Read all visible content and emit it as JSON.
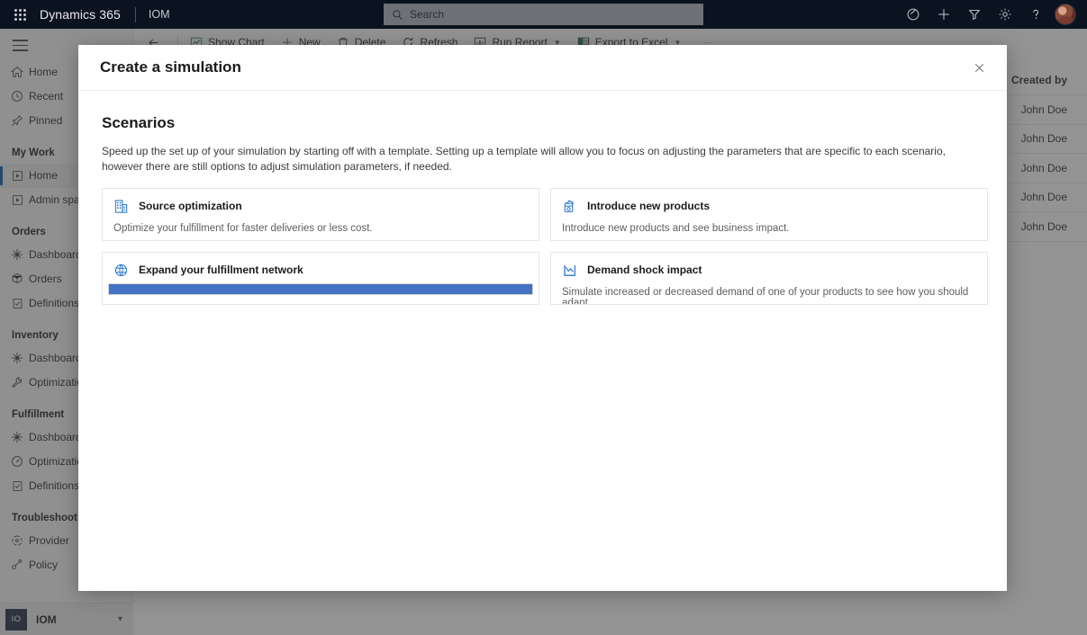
{
  "appbar": {
    "waffle_label": "App launcher",
    "brand": "Dynamics 365",
    "app_name": "IOM",
    "search_placeholder": "Search",
    "actions": [
      {
        "name": "pin-annotate-icon",
        "label": "Annotate"
      },
      {
        "name": "plus-icon",
        "label": "New"
      },
      {
        "name": "filter-icon",
        "label": "Filter"
      },
      {
        "name": "gear-icon",
        "label": "Settings"
      },
      {
        "name": "question-icon",
        "label": "Help"
      }
    ],
    "avatar_label": "Account manager"
  },
  "sidebar": {
    "menu_label": "Collapse navigation",
    "quick": [
      {
        "label": "Home",
        "icon": "home-icon"
      },
      {
        "label": "Recent",
        "icon": "clock-icon"
      },
      {
        "label": "Pinned",
        "icon": "pin-icon"
      }
    ],
    "groups": [
      {
        "title": "My Work",
        "items": [
          {
            "label": "Home",
            "icon": "play-box-icon",
            "selected": true
          },
          {
            "label": "Admin space",
            "icon": "play-box-icon",
            "selected": false
          }
        ]
      },
      {
        "title": "Orders",
        "items": [
          {
            "label": "Dashboard",
            "icon": "dashboard-icon",
            "selected": false
          },
          {
            "label": "Orders",
            "icon": "box-icon",
            "selected": false
          },
          {
            "label": "Definitions",
            "icon": "checklist-icon",
            "selected": false
          }
        ]
      },
      {
        "title": "Inventory",
        "items": [
          {
            "label": "Dashboard",
            "icon": "dashboard-icon",
            "selected": false
          },
          {
            "label": "Optimization",
            "icon": "wrench-icon",
            "selected": false
          }
        ]
      },
      {
        "title": "Fulfillment",
        "items": [
          {
            "label": "Dashboard",
            "icon": "dashboard-icon",
            "selected": false
          },
          {
            "label": "Optimization",
            "icon": "gauge-icon",
            "selected": false
          },
          {
            "label": "Definitions",
            "icon": "checklist-icon",
            "selected": false
          }
        ]
      },
      {
        "title": "Troubleshoot",
        "items": [
          {
            "label": "Provider",
            "icon": "node-icon",
            "selected": false
          },
          {
            "label": "Policy",
            "icon": "policy-icon",
            "selected": false
          }
        ]
      }
    ],
    "environment": {
      "initials": "IO",
      "name": "IOM",
      "chevron": "switch-environment"
    }
  },
  "commandbar": {
    "back_label": "Back",
    "items": [
      {
        "label": "Show Chart",
        "icon": "chart-icon",
        "chevron": false
      },
      {
        "label": "New",
        "icon": "plus-icon",
        "chevron": false
      },
      {
        "label": "Delete",
        "icon": "trash-icon",
        "chevron": false
      },
      {
        "label": "Refresh",
        "icon": "refresh-icon",
        "chevron": false
      },
      {
        "label": "Run Report",
        "icon": "report-icon",
        "chevron": true
      },
      {
        "label": "Export to Excel",
        "icon": "excel-icon",
        "chevron": true
      }
    ],
    "overflow_label": "More commands"
  },
  "background_grid": {
    "created_by_header": "Created by",
    "rows": [
      {
        "created_by": "John Doe"
      },
      {
        "created_by": "John Doe"
      },
      {
        "created_by": "John Doe"
      },
      {
        "created_by": "John Doe"
      },
      {
        "created_by": "John Doe"
      }
    ]
  },
  "modal": {
    "title": "Create a simulation",
    "close_label": "Close",
    "section_title": "Scenarios",
    "section_description": "Speed up the set up of your simulation by starting off with a template. Setting up a template will allow you to focus on adjusting the parameters that are specific to each scenario, however there are still options to adjust simulation parameters, if needed.",
    "cards": [
      {
        "title": "Source optimization",
        "subtitle": "Optimize your fulfillment for faster deliveries or less cost.",
        "icon": "building-icon",
        "loading": false,
        "progress": 0
      },
      {
        "title": "Introduce new products",
        "subtitle": "Introduce new products and see business impact.",
        "icon": "cube-icon",
        "loading": false,
        "progress": 0
      },
      {
        "title": "Expand your fulfillment network",
        "subtitle": "",
        "icon": "globe-icon",
        "loading": true,
        "progress": 100
      },
      {
        "title": "Demand shock impact",
        "subtitle": "Simulate increased or decreased demand of one of your products to see how you should adapt.",
        "icon": "linechart-icon",
        "loading": false,
        "progress": 0
      }
    ]
  },
  "colors": {
    "accent": "#0b5cab",
    "progress_blue": "#4472c4",
    "appbar_bg": "#0b1220",
    "icon_blue": "#2673cf"
  }
}
